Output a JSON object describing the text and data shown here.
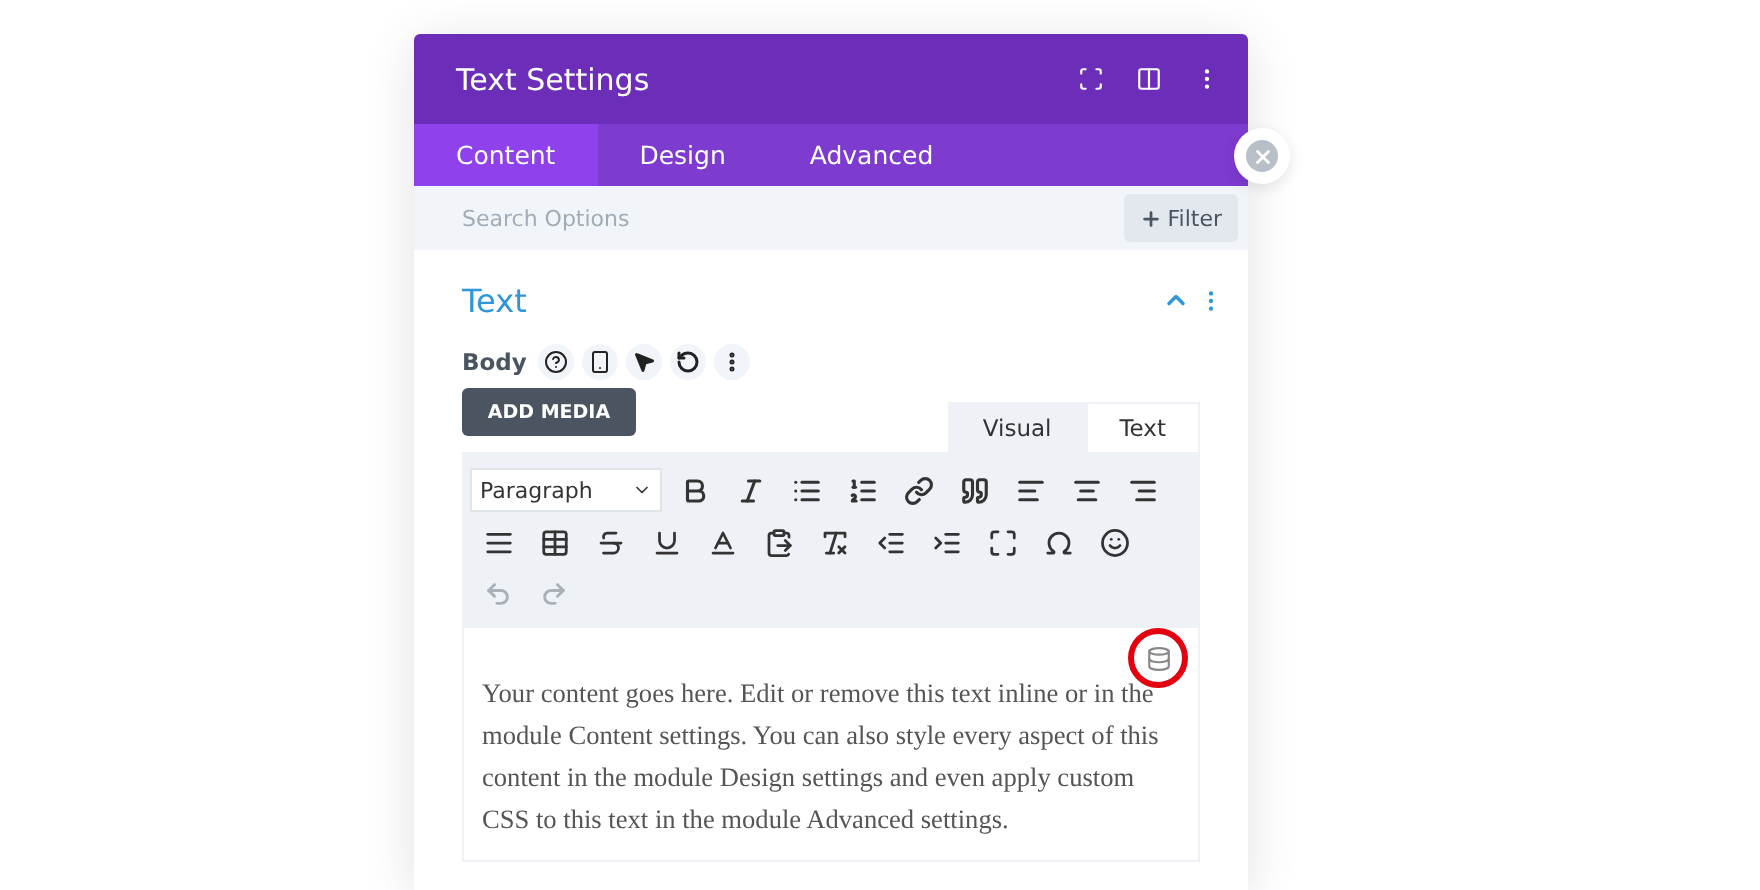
{
  "window": {
    "title": "Text Settings"
  },
  "tabs": [
    {
      "label": "Content",
      "selected": true
    },
    {
      "label": "Design",
      "selected": false
    },
    {
      "label": "Advanced",
      "selected": false
    }
  ],
  "search": {
    "placeholder": "Search Options"
  },
  "filter_button": "Filter",
  "section": {
    "title": "Text",
    "expanded": true
  },
  "field": {
    "label": "Body"
  },
  "add_media": "ADD MEDIA",
  "editor_tabs": [
    {
      "label": "Visual",
      "selected": true
    },
    {
      "label": "Text",
      "selected": false
    }
  ],
  "format_select": "Paragraph",
  "content": "Your content goes here. Edit or remove this text inline or in the module Content settings. You can also style every aspect of this content in the module Design settings and even apply custom CSS to this text in the module Advanced settings."
}
